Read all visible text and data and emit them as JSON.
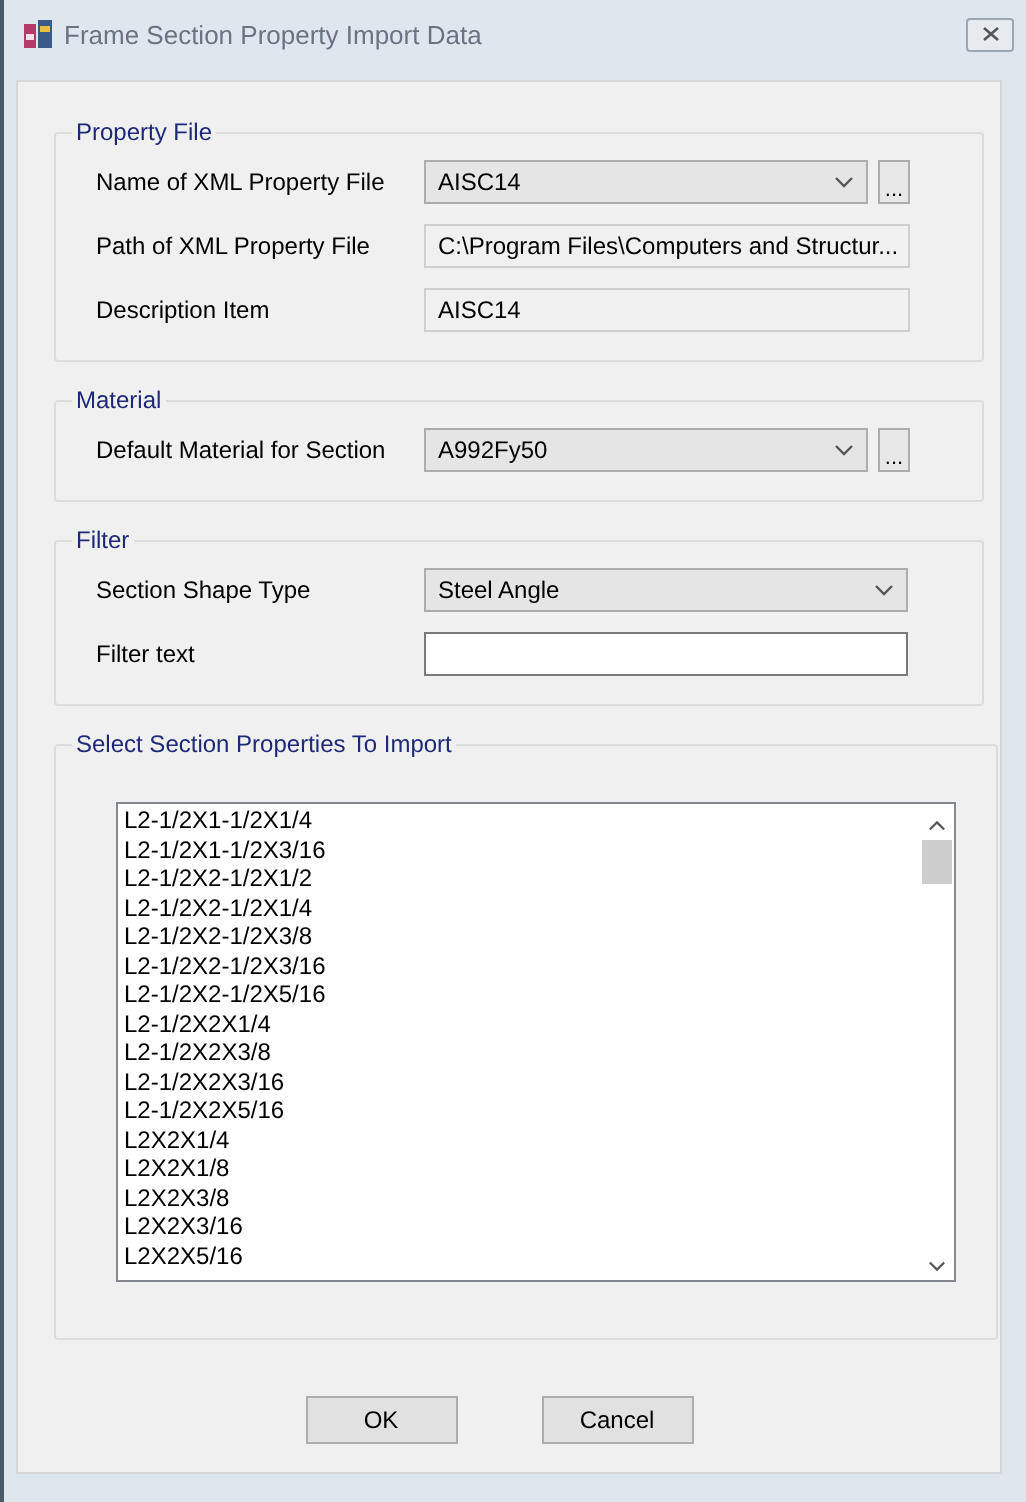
{
  "window": {
    "title": "Frame Section Property Import Data"
  },
  "groups": [
    {
      "title": "Property File",
      "rows": [
        {
          "kind": "combo",
          "label": "Name of XML Property File",
          "value": "AISC14",
          "browse": "..."
        },
        {
          "kind": "readonly",
          "label": "Path of XML Property File",
          "value": "C:\\Program Files\\Computers and Structur..."
        },
        {
          "kind": "readonly",
          "label": "Description Item",
          "value": "AISC14"
        }
      ]
    },
    {
      "title": "Material",
      "rows": [
        {
          "kind": "combo",
          "label": "Default Material for Section",
          "value": "A992Fy50",
          "browse": "..."
        }
      ]
    },
    {
      "title": "Filter",
      "rows": [
        {
          "kind": "combo",
          "label": "Section Shape Type",
          "value": "Steel Angle"
        },
        {
          "kind": "text",
          "label": "Filter text"
        }
      ]
    }
  ],
  "section_list": {
    "title": "Select Section Properties To Import",
    "items": [
      "L2-1/2X1-1/2X1/4",
      "L2-1/2X1-1/2X3/16",
      "L2-1/2X2-1/2X1/2",
      "L2-1/2X2-1/2X1/4",
      "L2-1/2X2-1/2X3/8",
      "L2-1/2X2-1/2X3/16",
      "L2-1/2X2-1/2X5/16",
      "L2-1/2X2X1/4",
      "L2-1/2X2X3/8",
      "L2-1/2X2X3/16",
      "L2-1/2X2X5/16",
      "L2X2X1/4",
      "L2X2X1/8",
      "L2X2X3/8",
      "L2X2X3/16",
      "L2X2X5/16"
    ]
  },
  "buttons": [
    "OK",
    "Cancel"
  ]
}
